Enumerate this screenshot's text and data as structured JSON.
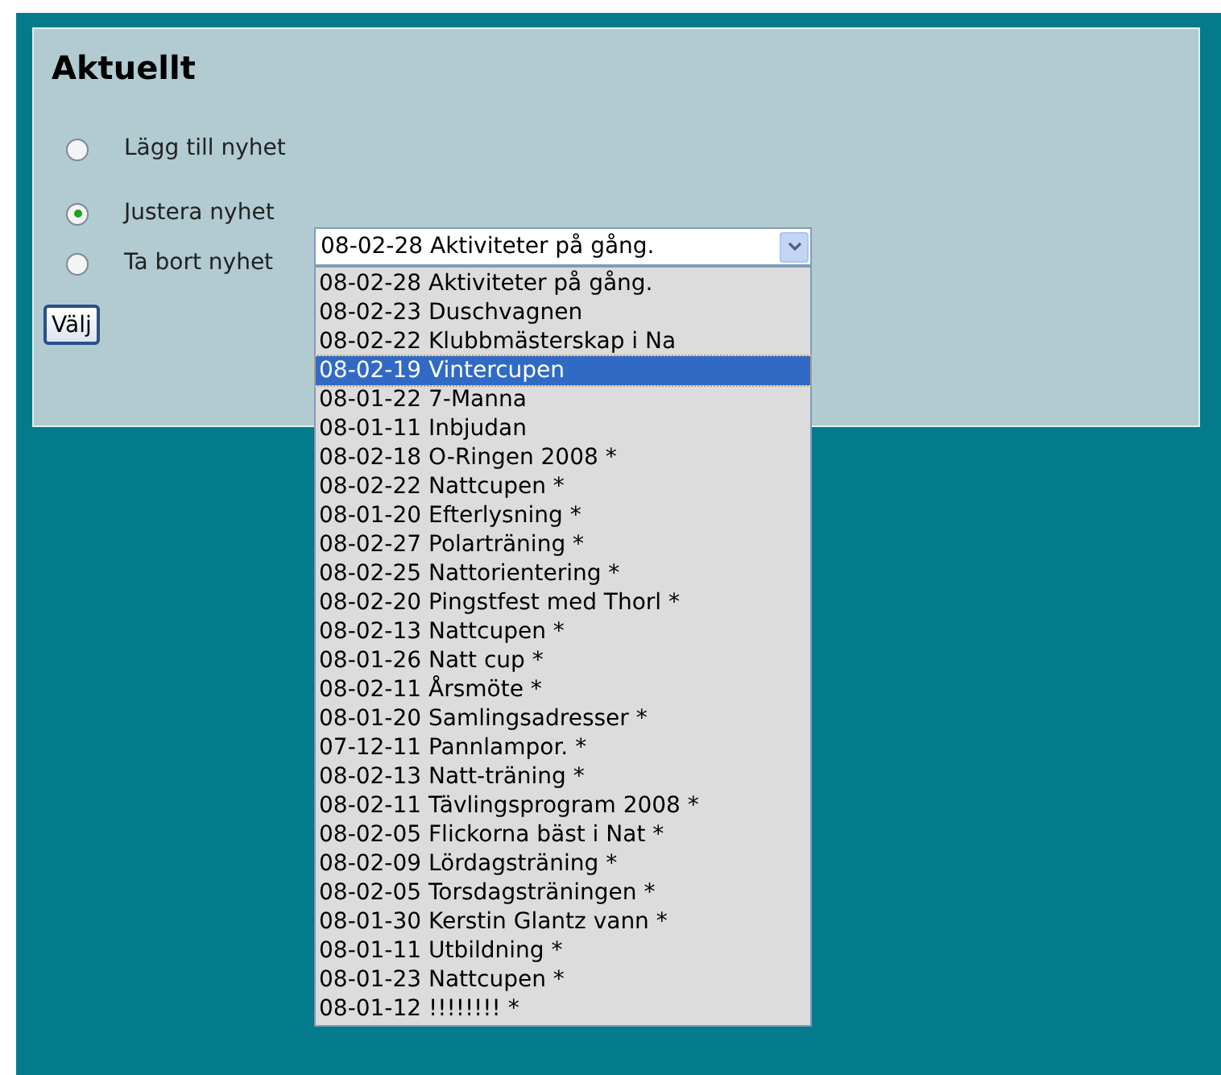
{
  "heading": "Aktuellt",
  "options": [
    {
      "label": "Lägg till nyhet",
      "selected": false
    },
    {
      "label": "Justera nyhet",
      "selected": true
    },
    {
      "label": "Ta bort nyhet",
      "selected": false
    }
  ],
  "dropdown": {
    "value": "08-02-28 Aktiviteter på gång.",
    "expanded": true,
    "items": [
      {
        "label": "08-02-28 Aktiviteter på gång.",
        "highlighted": false
      },
      {
        "label": "08-02-23 Duschvagnen",
        "highlighted": false
      },
      {
        "label": "08-02-22 Klubbmästerskap i Na",
        "highlighted": false
      },
      {
        "label": "08-02-19 Vintercupen",
        "highlighted": true
      },
      {
        "label": "08-01-22 7-Manna",
        "highlighted": false
      },
      {
        "label": "08-01-11 Inbjudan",
        "highlighted": false
      },
      {
        "label": "08-02-18 O-Ringen 2008 *",
        "highlighted": false
      },
      {
        "label": "08-02-22 Nattcupen *",
        "highlighted": false
      },
      {
        "label": "08-01-20 Efterlysning *",
        "highlighted": false
      },
      {
        "label": "08-02-27 Polarträning *",
        "highlighted": false
      },
      {
        "label": "08-02-25 Nattorientering *",
        "highlighted": false
      },
      {
        "label": "08-02-20 Pingstfest med Thorl *",
        "highlighted": false
      },
      {
        "label": "08-02-13 Nattcupen *",
        "highlighted": false
      },
      {
        "label": "08-01-26 Natt cup *",
        "highlighted": false
      },
      {
        "label": "08-02-11 Årsmöte *",
        "highlighted": false
      },
      {
        "label": "08-01-20 Samlingsadresser *",
        "highlighted": false
      },
      {
        "label": "07-12-11 Pannlampor. *",
        "highlighted": false
      },
      {
        "label": "08-02-13 Natt-träning *",
        "highlighted": false
      },
      {
        "label": "08-02-11 Tävlingsprogram 2008 *",
        "highlighted": false
      },
      {
        "label": "08-02-05 Flickorna bäst i Nat *",
        "highlighted": false
      },
      {
        "label": "08-02-09 Lördagsträning *",
        "highlighted": false
      },
      {
        "label": "08-02-05 Torsdagsträningen *",
        "highlighted": false
      },
      {
        "label": "08-01-30 Kerstin Glantz vann *",
        "highlighted": false
      },
      {
        "label": "08-01-11 Utbildning *",
        "highlighted": false
      },
      {
        "label": "08-01-23 Nattcupen *",
        "highlighted": false
      },
      {
        "label": "08-01-12 !!!!!!!! *",
        "highlighted": false
      }
    ]
  },
  "button": "Välj"
}
